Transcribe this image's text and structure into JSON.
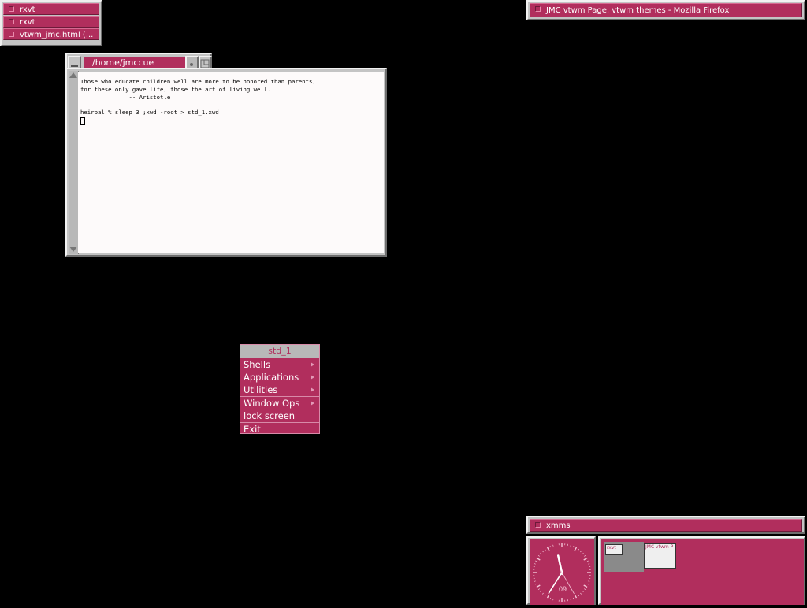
{
  "icon_manager": {
    "items": [
      {
        "label": "rxvt"
      },
      {
        "label": "rxvt"
      },
      {
        "label": "vtwm_jmc.html (..."
      }
    ]
  },
  "firefox_bar": {
    "label": "JMC vtwm Page, vtwm themes - Mozilla Firefox"
  },
  "terminal": {
    "title": "/home/jmccue",
    "lines": [
      "Those who educate children well are more to be honored than parents,",
      "for these only gave life, those the art of living well.",
      "              -- Aristotle",
      "",
      "heirbal % sleep 3 ;xwd -root > std_1.xwd"
    ]
  },
  "root_menu": {
    "title": "std_1",
    "items": [
      {
        "label": "Shells",
        "submenu": true
      },
      {
        "label": "Applications",
        "submenu": true
      },
      {
        "label": "Utilities",
        "submenu": true
      },
      {
        "label": "Window Ops",
        "submenu": true
      },
      {
        "label": "lock screen",
        "submenu": false
      },
      {
        "label": "Exit",
        "submenu": false
      }
    ]
  },
  "xmms_bar": {
    "label": "xmms"
  },
  "clock": {
    "hour": 11,
    "minute": 35,
    "second": 25,
    "date_label": "09"
  },
  "pager": {
    "windows": [
      {
        "label": "rxvt"
      },
      {
        "label": "JMC vtwm P"
      }
    ]
  },
  "colors": {
    "accent": "#b12e5d",
    "frame": "#c4c4c4",
    "desktop": "#000000"
  }
}
